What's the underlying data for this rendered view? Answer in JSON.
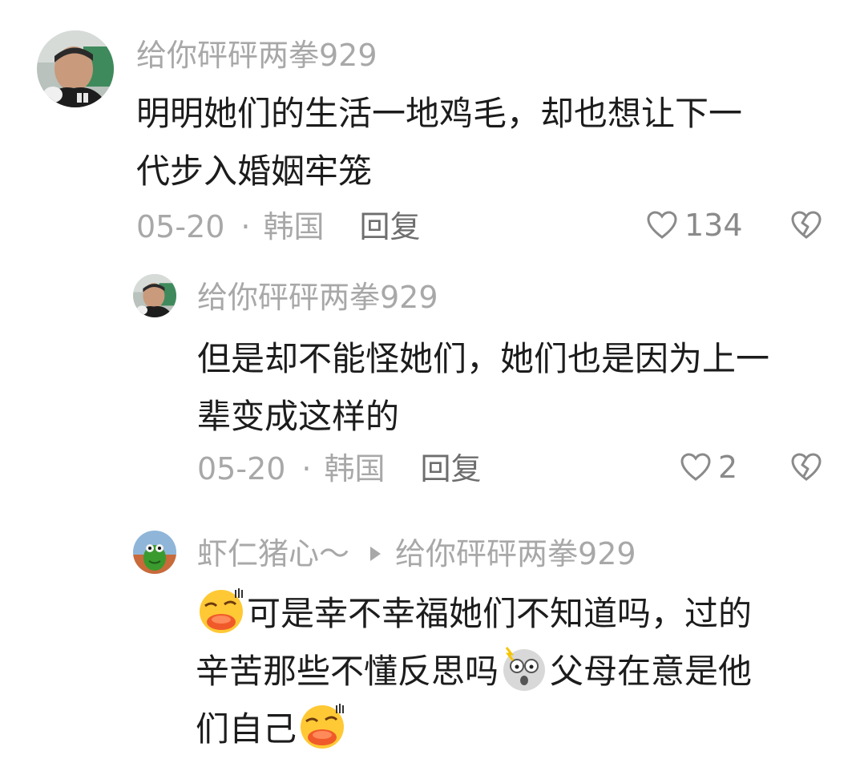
{
  "comments": [
    {
      "username": "给你砰砰两拳929",
      "lines": [
        "明明她们的生活一地鸡毛，却也想让下一",
        "代步入婚姻牢笼"
      ],
      "date": "05-20",
      "location": "韩国",
      "reply_label": "回复",
      "likes": "134"
    },
    {
      "username": "给你砰砰两拳929",
      "lines": [
        "但是却不能怪她们，她们也是因为上一",
        "辈变成这样的"
      ],
      "date": "05-20",
      "location": "韩国",
      "reply_label": "回复",
      "likes": "2"
    },
    {
      "username": "虾仁猪心～",
      "reply_to": "给你砰砰两拳929",
      "line1": "可是幸不幸福她们不知道吗，过的",
      "line2a": "辛苦那些不懂反思吗",
      "line2b": "父母在意是他",
      "line3": "们自己"
    }
  ],
  "icons": {
    "like": "heart-outline-icon",
    "dislike": "broken-heart-icon",
    "emoji_1": "blowing-kiss-face-emoji",
    "emoji_2": "shocked-face-emoji"
  },
  "colors": {
    "username": "#a8a8a8",
    "body": "#1c1c1c",
    "meta": "#a8a8a8",
    "reply": "#6e6e6e"
  }
}
